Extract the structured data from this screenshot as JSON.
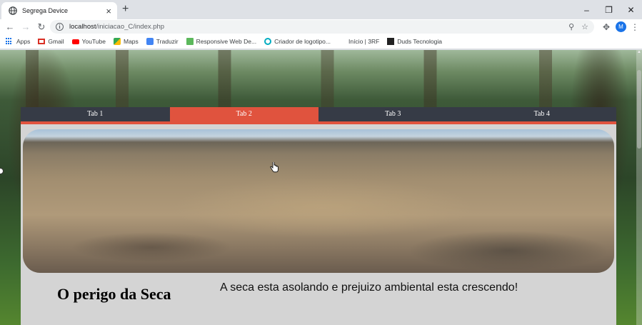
{
  "browser": {
    "tab_title": "Segrega Device",
    "url_host": "localhost",
    "url_path": "/iniciacao_C/index.php",
    "profile_initial": "M",
    "bookmarks": [
      {
        "label": "Apps",
        "icon": "apps-grid-icon",
        "color": "#1a73e8"
      },
      {
        "label": "Gmail",
        "icon": "gmail-icon",
        "color": "#d93025"
      },
      {
        "label": "YouTube",
        "icon": "youtube-icon",
        "color": "#ff0000"
      },
      {
        "label": "Maps",
        "icon": "maps-icon",
        "color": "#34a853"
      },
      {
        "label": "Traduzir",
        "icon": "translate-icon",
        "color": "#4285f4"
      },
      {
        "label": "Responsive Web De...",
        "icon": "responsive-icon",
        "color": "#5cb85c"
      },
      {
        "label": "Criador de logotipo...",
        "icon": "logo-creator-icon",
        "color": "#00acc1"
      },
      {
        "label": "Início | 3RF",
        "icon": "",
        "color": ""
      },
      {
        "label": "Duds Tecnologia",
        "icon": "duds-icon",
        "color": "#222222"
      }
    ]
  },
  "page": {
    "tabs": [
      "Tab 1",
      "Tab 2",
      "Tab 3",
      "Tab 4"
    ],
    "active_tab": "Tab 2",
    "heading": "O perigo da Seca",
    "text": "A seca esta asolando e prejuizo ambiental esta crescendo!"
  },
  "colors": {
    "tab_bar": "#363b46",
    "tab_active": "#e0533e",
    "card_bg": "#d4d4d4"
  }
}
